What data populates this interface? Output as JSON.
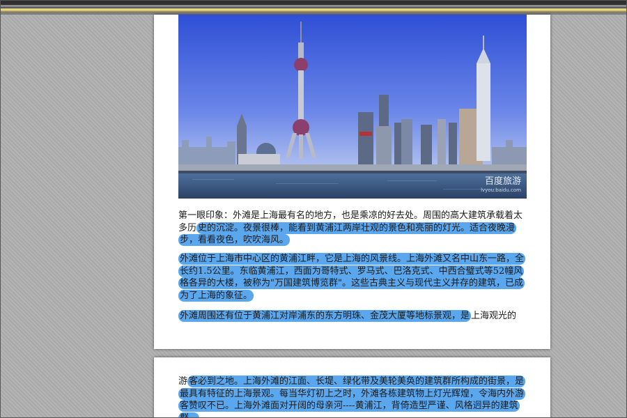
{
  "document": {
    "page1": {
      "photo": {
        "watermark": "百度旅游",
        "watermark_url": "lvyou.baidu.com"
      },
      "p1": {
        "plain": "第一眼印象：外滩是上海最有名的地方，也是乘凉的好去处。周围的高大建筑承载着太多历",
        "highlighted": "史的沉淀。夜景很棒，能看到黄浦江两岸壮观的景色和亮丽的灯光。适合夜晚漫步，看看夜色，吹吹海风。"
      },
      "p2": {
        "highlighted": "外滩位于上海市中心区的黄浦江畔，它是上海的风景线。上海外滩又名中山东一路，全长约1.5公里。东临黄浦江，西面为哥特式、罗马式、巴洛克式、中西合璧式等52幢风格各异的大楼，被称为\"万国建筑博览群\"。这些古典主义与现代主义并存的建筑，已成为了上海的象征。"
      },
      "p3": {
        "highlighted": "外滩周围还有位于黄浦江对岸浦东的东方明珠、金茂大厦等地标景观，是",
        "plain": "上海观光的"
      }
    },
    "page2": {
      "p4": {
        "plain": "游",
        "highlighted": "客必到之地。上海外滩的江面、长堤、绿化带及美轮美奂的建筑群所构成的街景，是最具有特征的上海景观。每当华灯初上之时，外滩各栋建筑物上灯光辉煌，令海内外游客赞叹不已。上海外滩面对开阔的母亲河----黄浦江，背倚造型严谨、风格迥异的建筑群。"
      }
    }
  },
  "colors": {
    "highlight": "#5aa7ee",
    "sky": "#4a64d9",
    "water": "#3b5a86"
  }
}
